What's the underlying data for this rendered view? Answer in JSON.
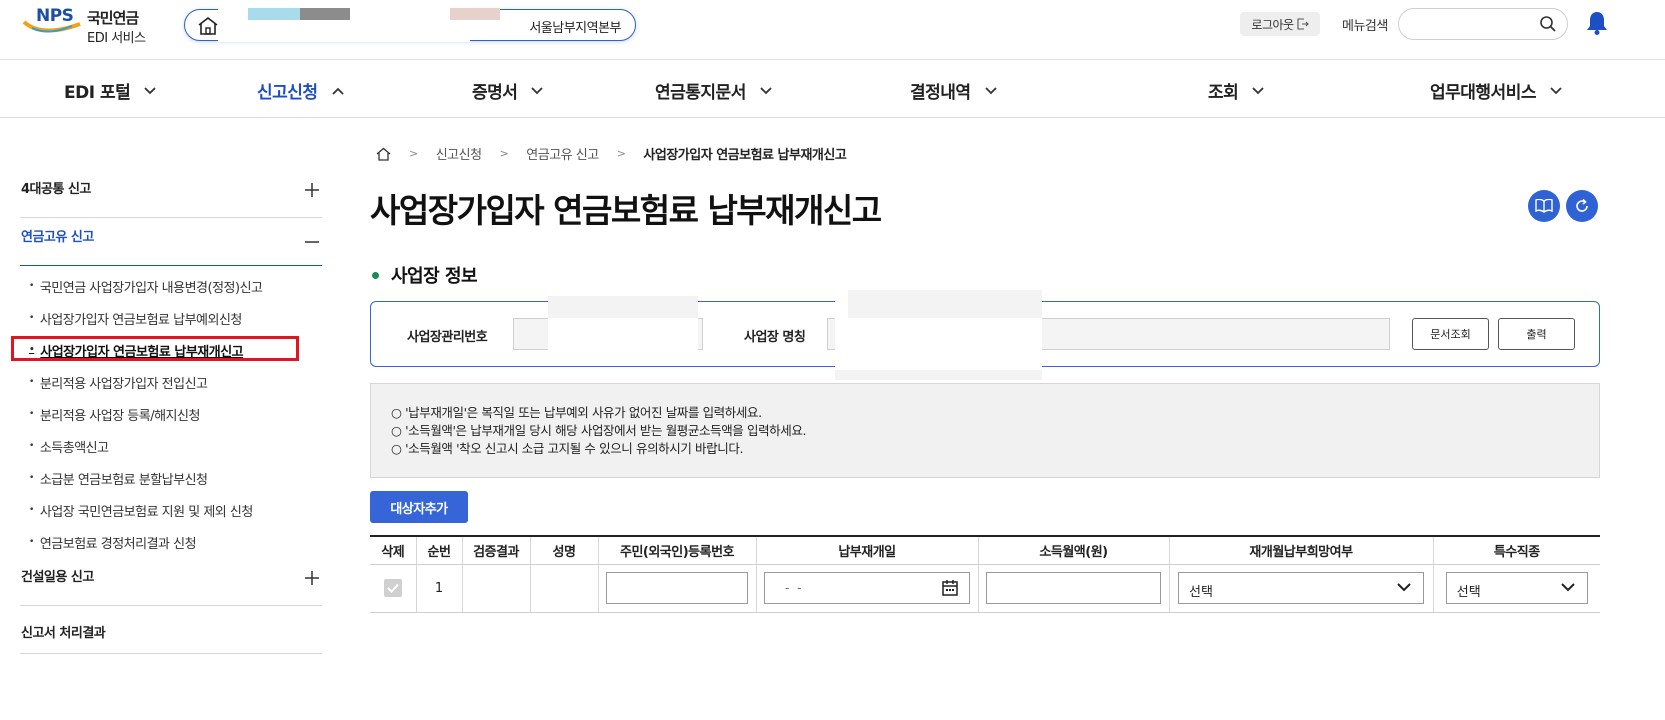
{
  "header": {
    "logo": {
      "brand": "NPS",
      "name_kr": "국민연금",
      "service": "EDI 서비스"
    },
    "branch": "서울남부지역본부",
    "logout_label": "로그아웃",
    "menu_search_label": "메뉴검색",
    "menu_search_value": ""
  },
  "gnb": [
    {
      "label": "EDI 포털",
      "expanded": false
    },
    {
      "label": "신고신청",
      "expanded": true
    },
    {
      "label": "증명서",
      "expanded": false
    },
    {
      "label": "연금통지문서",
      "expanded": false
    },
    {
      "label": "결정내역",
      "expanded": false
    },
    {
      "label": "조회",
      "expanded": false
    },
    {
      "label": "업무대행서비스",
      "expanded": false
    }
  ],
  "lnb": {
    "groups": [
      {
        "title": "4대공통 신고",
        "toggle": "+"
      },
      {
        "title": "연금고유 신고",
        "toggle": "—",
        "items": [
          "국민연금 사업장가입자 내용변경(정정)신고",
          "사업장가입자 연금보험료 납부예외신청",
          "사업장가입자 연금보험료 납부재개신고",
          "분리적용 사업장가입자 전입신고",
          "분리적용 사업장 등록/해지신청",
          "소득총액신고",
          "소급분 연금보험료 분할납부신청",
          "사업장 국민연금보험료 지원 및 제외 신청",
          "연금보험료 경정처리결과 신청"
        ],
        "current_index": 2
      },
      {
        "title": "건설일용 신고",
        "toggle": "+"
      },
      {
        "title": "신고서 처리결과",
        "toggle": ""
      }
    ]
  },
  "breadcrumb": [
    "신고신청",
    "연금고유 신고",
    "사업장가입자 연금보험료 납부재개신고"
  ],
  "page_title": "사업장가입자 연금보험료 납부재개신고",
  "section_title": "사업장 정보",
  "biz_info": {
    "mgmt_no_label": "사업장관리번호",
    "mgmt_no_value": "",
    "name_label": "사업장 명칭",
    "name_value": "",
    "doc_search_label": "문서조회",
    "print_label": "출력"
  },
  "notice": [
    "○ '납부재개일'은 복직일 또는 납부예외 사유가 없어진 날짜를 입력하세요.",
    "○ '소득월액'은 납부재개일 당시 해당 사업장에서 받는 월평균소득액을 입력하세요.",
    "○ '소득월액 '착오 신고시 소급 고지될 수 있으니 유의하시기 바랍니다."
  ],
  "add_button_label": "대상자추가",
  "table": {
    "headers": [
      "삭제",
      "순번",
      "검증결과",
      "성명",
      "주민(외국인)등록번호",
      "납부재개일",
      "소득월액(원)",
      "재개월납부희망여부",
      "특수직종"
    ],
    "rows": [
      {
        "delete_checked": true,
        "seq": "1",
        "result": "",
        "name": "",
        "rrn": "",
        "date": "- -",
        "income": "",
        "hope": "선택",
        "special": "선택"
      }
    ]
  },
  "colors": {
    "accent": "#3565d6",
    "active_nav": "#1d4fc4",
    "highlight": "#e0161e",
    "section_dot": "#1a8a5a"
  }
}
